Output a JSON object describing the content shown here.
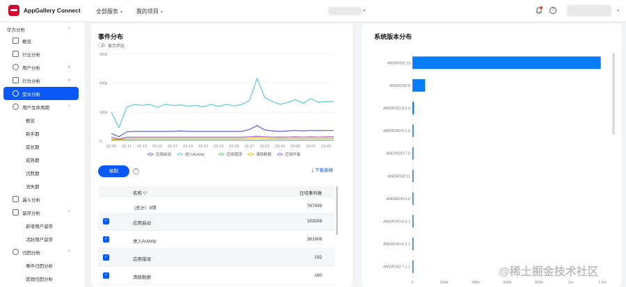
{
  "header": {
    "brand": "AppGallery Connect",
    "nav_all_services": "全部服务",
    "nav_my_projects": "我的项目"
  },
  "sidebar": {
    "section": "华为分析",
    "items": [
      {
        "label": "概览",
        "icon": "grid-icon"
      },
      {
        "label": "行业分析",
        "icon": "calendar-icon"
      },
      {
        "label": "用户分析",
        "icon": "user-icon"
      },
      {
        "label": "行为分析",
        "icon": "behavior-icon"
      },
      {
        "label": "受众分析",
        "icon": "audience-icon"
      },
      {
        "label": "用户生命周期",
        "icon": "lifecycle-icon"
      }
    ],
    "lifecycle_sub": [
      "概览",
      "新手期",
      "成长期",
      "成熟期",
      "沉默期",
      "流失期"
    ],
    "funnel": "漏斗分析",
    "retention": "留存分析",
    "retention_sub": [
      "新增用户留存",
      "活跃用户留存"
    ],
    "attribution": "归因分析",
    "attribution_sub": [
      "事件归因分析",
      "营销归因分析"
    ]
  },
  "event_panel": {
    "title": "事件分布",
    "toggle_label": "显示环比",
    "draw_button": "绘制",
    "download": "下载表格",
    "table": {
      "col_name": "名称",
      "col_value": "日均事件数",
      "total_label": "(总计）9项",
      "total_value": "787499",
      "rows": [
        {
          "name": "应用启动",
          "value": "103208"
        },
        {
          "name": "进入Activity",
          "value": "381906"
        },
        {
          "name": "应用错误",
          "value": "192"
        },
        {
          "name": "清除数据",
          "value": "160"
        }
      ]
    }
  },
  "chart_data": [
    {
      "type": "line",
      "title": "",
      "x": [
        "02-09",
        "02-10",
        "02-11",
        "02-12",
        "02-13",
        "02-14",
        "02-15",
        "02-16",
        "02-17",
        "02-18",
        "02-19",
        "02-20",
        "02-21",
        "02-22",
        "02-23",
        "02-24",
        "02-25",
        "02-26",
        "02-27",
        "02-28",
        "03-01",
        "03-02",
        "03-03",
        "03-04",
        "03-05",
        "03-06",
        "03-07",
        "03-08",
        "03-09",
        "03-10"
      ],
      "x_tick_labels": [
        "02-09",
        "02-11",
        "02-13",
        "02-15",
        "02-17",
        "02-19",
        "02-21",
        "02-23",
        "02-25",
        "02-27",
        "03-01",
        "03-03",
        "03-05",
        "03-07",
        "03-09"
      ],
      "y_tick_labels": [
        "0",
        "300k",
        "600k",
        "900k"
      ],
      "ylim": [
        0,
        900000
      ],
      "series": [
        {
          "name": "应用启动",
          "color": "#5b5fd6",
          "values": [
            80000,
            45000,
            95000,
            100000,
            100000,
            100000,
            100000,
            100000,
            100000,
            105000,
            100000,
            100000,
            100000,
            100000,
            100000,
            100000,
            100000,
            100000,
            120000,
            160000,
            115000,
            105000,
            100000,
            105000,
            110000,
            105000,
            110000,
            108000,
            110000,
            110000
          ]
        },
        {
          "name": "进入Activity",
          "color": "#5ac8d8",
          "values": [
            300000,
            140000,
            350000,
            380000,
            370000,
            380000,
            350000,
            380000,
            370000,
            375000,
            360000,
            370000,
            355000,
            380000,
            360000,
            380000,
            365000,
            380000,
            420000,
            650000,
            450000,
            410000,
            380000,
            400000,
            430000,
            390000,
            440000,
            400000,
            410000,
            410000
          ]
        },
        {
          "name": "应用错误",
          "color": "#52c47a",
          "values": [
            10000,
            10000,
            10000,
            10000,
            10000,
            10000,
            10000,
            10000,
            10000,
            10000,
            10000,
            10000,
            10000,
            10000,
            10000,
            10000,
            10000,
            10000,
            10000,
            10000,
            10000,
            10000,
            10000,
            10000,
            10000,
            10000,
            10000,
            10000,
            10000,
            10000
          ]
        },
        {
          "name": "清除数据",
          "color": "#e8b400",
          "values": [
            20000,
            15000,
            25000,
            25000,
            25000,
            25000,
            25000,
            25000,
            25000,
            25000,
            25000,
            25000,
            25000,
            25000,
            25000,
            25000,
            25000,
            25000,
            30000,
            35000,
            30000,
            28000,
            26000,
            27000,
            28000,
            27000,
            28000,
            27000,
            28000,
            28000
          ]
        },
        {
          "name": "应用升级",
          "color": "#9b5fd6",
          "values": [
            40000,
            20000,
            40000,
            40000,
            40000,
            40000,
            40000,
            40000,
            40000,
            40000,
            40000,
            40000,
            40000,
            40000,
            40000,
            40000,
            40000,
            40000,
            45000,
            50000,
            45000,
            42000,
            40000,
            42000,
            44000,
            42000,
            44000,
            42000,
            44000,
            44000
          ]
        }
      ]
    },
    {
      "type": "bar",
      "title": "系统版本分布",
      "orientation": "horizontal",
      "categories": [
        "ANDROID:10",
        "ANDROID:9",
        "ANDROID:8.0.0",
        "ANDROID:8.1.0",
        "ANDROID:7.0",
        "ANDROID:11",
        "ANDROID:6.0",
        "ANDROID:6.0.1",
        "ANDROID:5.1.1",
        "ANDROID:7.1.1"
      ],
      "values": [
        1190000,
        80000,
        10000,
        7000,
        3000,
        2500,
        2000,
        1500,
        1000,
        800
      ],
      "x_tick_labels": [
        "0",
        "200k",
        "400k",
        "600k",
        "800k",
        "1m",
        "1.2m"
      ],
      "xlim": [
        0,
        1200000
      ],
      "color": "#0a7cf7"
    }
  ]
}
